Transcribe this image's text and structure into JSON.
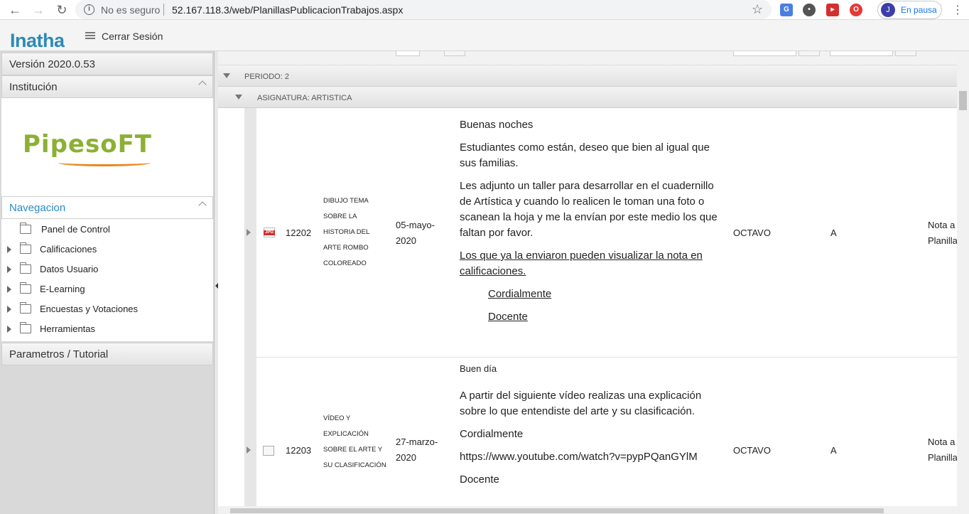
{
  "browser": {
    "not_secure": "No es seguro",
    "url": "52.167.118.3/web/PlanillasPublicacionTrabajos.aspx",
    "profile_initial": "J",
    "profile_status": "En pausa"
  },
  "header": {
    "logo": "Inatha",
    "logout": "Cerrar Sesión"
  },
  "sidebar": {
    "version": "Versión 2020.0.53",
    "institution_label": "Institución",
    "institution_logo": "PipesoFT",
    "nav_label": "Navegacion",
    "nav_items": [
      {
        "label": "Panel de Control",
        "expandable": false
      },
      {
        "label": "Calificaciones",
        "expandable": true
      },
      {
        "label": "Datos Usuario",
        "expandable": true
      },
      {
        "label": "E-Learning",
        "expandable": true
      },
      {
        "label": "Encuestas y Votaciones",
        "expandable": true
      },
      {
        "label": "Herramientas",
        "expandable": true
      }
    ],
    "params_label": "Parametros / Tutorial"
  },
  "groups": {
    "periodo": "PERIODO: 2",
    "asignatura": "ASIGNATURA: ARTISTICA"
  },
  "rows": [
    {
      "file_type": "JPG",
      "code": "12202",
      "title": "DIBUJO TEMA SOBRE LA HISTORIA DEL ARTE ROMBO COLOREADO",
      "date": "05-mayo-2020",
      "desc": {
        "p1": "Buenas noches",
        "p2": "Estudiantes como están, deseo que bien al igual que sus familias.",
        "p3": "Les adjunto un taller para desarrollar en el cuadernillo de Artística y cuando lo realicen le toman una foto o scanean la hoja y me la envían por este medio los que faltan por favor.",
        "p4": "Los que ya la enviaron pueden visualizar la nota en calificaciones.",
        "p5": "Cordialmente ",
        "p6": "Docente "
      },
      "grade": "OCTAVO",
      "group": "A",
      "note": "Nota a Planilla"
    },
    {
      "file_type": "",
      "code": "12203",
      "title": "VÍDEO Y EXPLICACIÓN SOBRE EL ARTE Y SU CLASIFICACIÓN",
      "date": "27-marzo-2020",
      "desc": {
        "p1": "Buen día",
        "p2": "A partir del siguiente vídeo realizas una explicación sobre lo que entendiste del arte y su clasificación.",
        "p3": "Cordialmente",
        "p4": "https://www.youtube.com/watch?v=pypPQanGYlM",
        "p5": "Docente"
      },
      "grade": "OCTAVO",
      "group": "A",
      "note": "Nota a Planilla"
    }
  ]
}
